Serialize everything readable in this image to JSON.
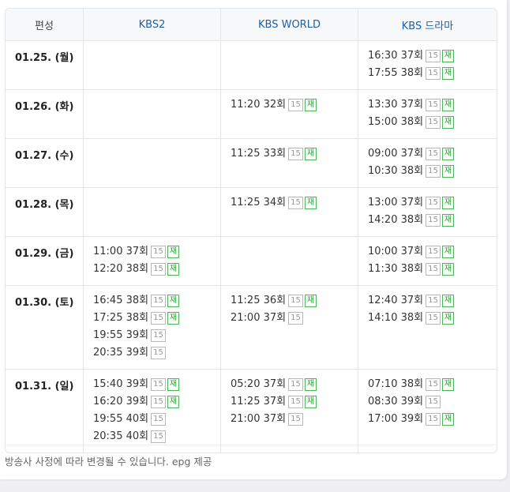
{
  "table": {
    "headers": [
      "편성",
      "KBS2",
      "KBS WORLD",
      "KBS 드라마"
    ],
    "rows": [
      {
        "date": "01.25. (월)",
        "kbs2": [],
        "world": [],
        "drama": [
          {
            "time": "16:30",
            "ep": "37회",
            "age": "15",
            "re": "재"
          },
          {
            "time": "17:55",
            "ep": "38회",
            "age": "15",
            "re": "재"
          }
        ]
      },
      {
        "date": "01.26. (화)",
        "kbs2": [],
        "world": [
          {
            "time": "11:20",
            "ep": "32회",
            "age": "15",
            "re": "재"
          }
        ],
        "drama": [
          {
            "time": "13:30",
            "ep": "37회",
            "age": "15",
            "re": "재"
          },
          {
            "time": "15:00",
            "ep": "38회",
            "age": "15",
            "re": "재"
          }
        ]
      },
      {
        "date": "01.27. (수)",
        "kbs2": [],
        "world": [
          {
            "time": "11:25",
            "ep": "33회",
            "age": "15",
            "re": "재"
          }
        ],
        "drama": [
          {
            "time": "09:00",
            "ep": "37회",
            "age": "15",
            "re": "재"
          },
          {
            "time": "10:30",
            "ep": "38회",
            "age": "15",
            "re": "재"
          }
        ]
      },
      {
        "date": "01.28. (목)",
        "kbs2": [],
        "world": [
          {
            "time": "11:25",
            "ep": "34회",
            "age": "15",
            "re": "재"
          }
        ],
        "drama": [
          {
            "time": "13:00",
            "ep": "37회",
            "age": "15",
            "re": "재"
          },
          {
            "time": "14:20",
            "ep": "38회",
            "age": "15",
            "re": "재"
          }
        ]
      },
      {
        "date": "01.29. (금)",
        "kbs2": [
          {
            "time": "11:00",
            "ep": "37회",
            "age": "15",
            "re": "재"
          },
          {
            "time": "12:20",
            "ep": "38회",
            "age": "15",
            "re": "재"
          }
        ],
        "world": [],
        "drama": [
          {
            "time": "10:00",
            "ep": "37회",
            "age": "15",
            "re": "재"
          },
          {
            "time": "11:30",
            "ep": "38회",
            "age": "15",
            "re": "재"
          }
        ]
      },
      {
        "date": "01.30. (토)",
        "kbs2": [
          {
            "time": "16:45",
            "ep": "38회",
            "age": "15",
            "re": "재"
          },
          {
            "time": "17:25",
            "ep": "38회",
            "age": "15",
            "re": "재"
          },
          {
            "time": "19:55",
            "ep": "39회",
            "age": "15",
            "re": ""
          },
          {
            "time": "20:35",
            "ep": "39회",
            "age": "15",
            "re": ""
          }
        ],
        "world": [
          {
            "time": "11:25",
            "ep": "36회",
            "age": "15",
            "re": "재"
          },
          {
            "time": "21:00",
            "ep": "37회",
            "age": "15",
            "re": ""
          }
        ],
        "drama": [
          {
            "time": "12:40",
            "ep": "37회",
            "age": "15",
            "re": "재"
          },
          {
            "time": "14:10",
            "ep": "38회",
            "age": "15",
            "re": "재"
          }
        ]
      },
      {
        "date": "01.31. (일)",
        "kbs2": [
          {
            "time": "15:40",
            "ep": "39회",
            "age": "15",
            "re": "재"
          },
          {
            "time": "16:20",
            "ep": "39회",
            "age": "15",
            "re": "재"
          },
          {
            "time": "19:55",
            "ep": "40회",
            "age": "15",
            "re": ""
          },
          {
            "time": "20:35",
            "ep": "40회",
            "age": "15",
            "re": ""
          }
        ],
        "world": [
          {
            "time": "05:20",
            "ep": "37회",
            "age": "15",
            "re": "재"
          },
          {
            "time": "11:25",
            "ep": "37회",
            "age": "15",
            "re": "재"
          },
          {
            "time": "21:00",
            "ep": "37회",
            "age": "15",
            "re": ""
          }
        ],
        "drama": [
          {
            "time": "07:10",
            "ep": "38회",
            "age": "15",
            "re": "재"
          },
          {
            "time": "08:30",
            "ep": "39회",
            "age": "15",
            "re": ""
          },
          {
            "time": "17:00",
            "ep": "39회",
            "age": "15",
            "re": "재"
          }
        ]
      }
    ]
  },
  "footer": {
    "note": "방송사 사정에 따라 변경될 수 있습니다. epg 제공"
  },
  "colors": {
    "channel_header": "#1d5fa6",
    "rerun_badge": "#2e9b3a",
    "age_badge": "#999999",
    "border": "#e3e6ea",
    "header_bg": "#f7f8fa"
  }
}
